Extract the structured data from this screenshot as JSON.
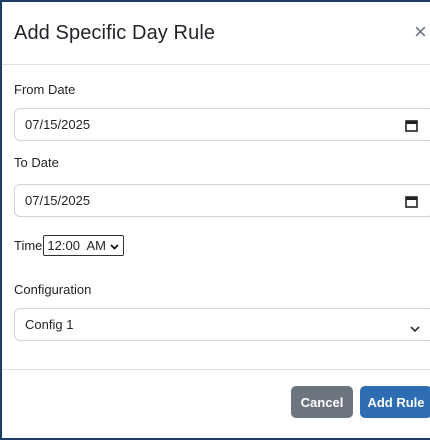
{
  "modal": {
    "title": "Add Specific Day Rule",
    "close_glyph": "×"
  },
  "form": {
    "from_date": {
      "label": "From Date",
      "value": "07/15/2025"
    },
    "to_date": {
      "label": "To Date",
      "value": "07/15/2025"
    },
    "time": {
      "label": "Time",
      "value": "12:00  AM"
    },
    "configuration": {
      "label": "Configuration",
      "value": "Config 1"
    }
  },
  "footer": {
    "cancel_label": "Cancel",
    "add_label": "Add Rule"
  },
  "colors": {
    "accent": "#2f6db3",
    "secondary": "#6c757d",
    "frame": "#1d3f66"
  },
  "icons": [
    "close-icon",
    "calendar-icon",
    "chevron-down-icon"
  ]
}
